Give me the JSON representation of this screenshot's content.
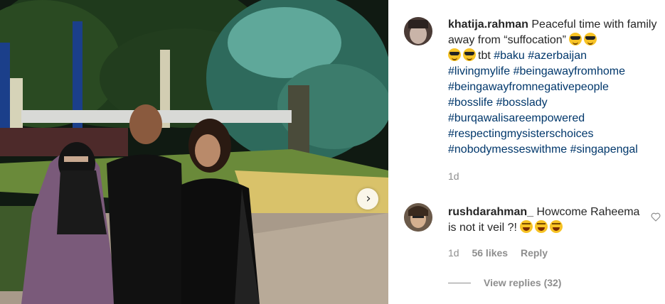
{
  "photo": {
    "alt": "Four people posing at night in a garden with palm trees"
  },
  "post": {
    "username": "khatija.rahman",
    "caption_text": " Peaceful time with family away from “suffocation” ",
    "tbt": "tbt ",
    "hashtags": [
      "#baku",
      "#azerbaijan",
      "#livingmylife",
      "#beingawayfromhome",
      "#beingawayfromnegativepeople",
      "#bosslife",
      "#bosslady",
      "#burqawalisareempowered",
      "#respectingmysisterschoices",
      "#nobodymesseswithme",
      "#singapengal"
    ],
    "time": "1d"
  },
  "comment": {
    "username": "rushdarahman_",
    "text": " Howcome Raheema is not it veil ?! ",
    "time": "1d",
    "likes": "56 likes",
    "reply": "Reply"
  },
  "view_replies": "View replies (32)",
  "icons": {
    "next": "chevron-right-icon",
    "like": "heart-icon"
  }
}
